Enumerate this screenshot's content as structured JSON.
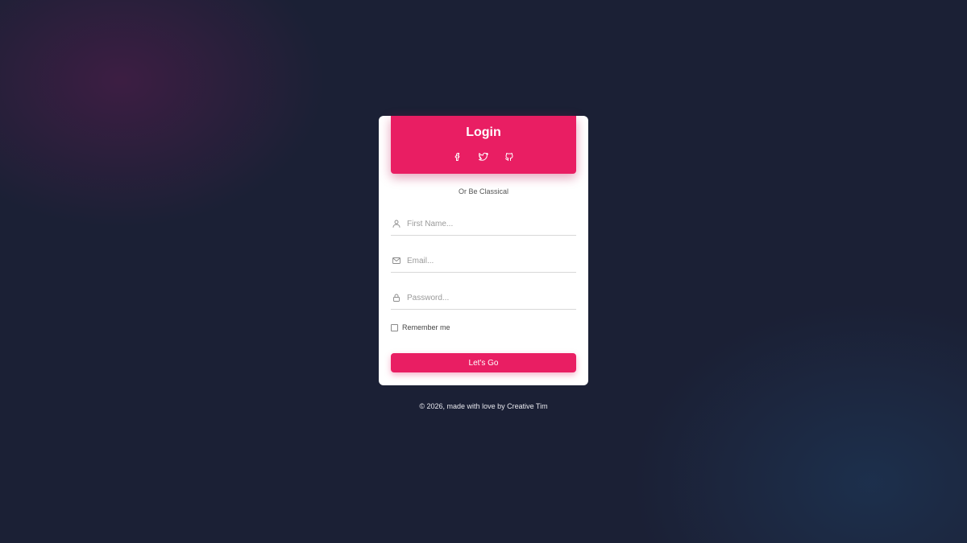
{
  "login_card": {
    "title": "Login",
    "social": [
      {
        "name": "facebook",
        "icon": "facebook-icon"
      },
      {
        "name": "twitter",
        "icon": "twitter-icon"
      },
      {
        "name": "github",
        "icon": "github-icon"
      }
    ],
    "subtitle": "Or Be Classical",
    "fields": {
      "first_name": {
        "placeholder": "First Name...",
        "value": "",
        "icon": "user-icon"
      },
      "email": {
        "placeholder": "Email...",
        "value": "",
        "icon": "mail-icon"
      },
      "password": {
        "placeholder": "Password...",
        "value": "",
        "icon": "lock-icon"
      }
    },
    "remember_label": "Remember me",
    "remember_checked": false,
    "submit_label": "Let's Go"
  },
  "footer": {
    "text": "© 2026, made with love by Creative Tim"
  },
  "colors": {
    "accent": "#e91e63",
    "background": "#1b2035",
    "card": "#ffffff"
  }
}
